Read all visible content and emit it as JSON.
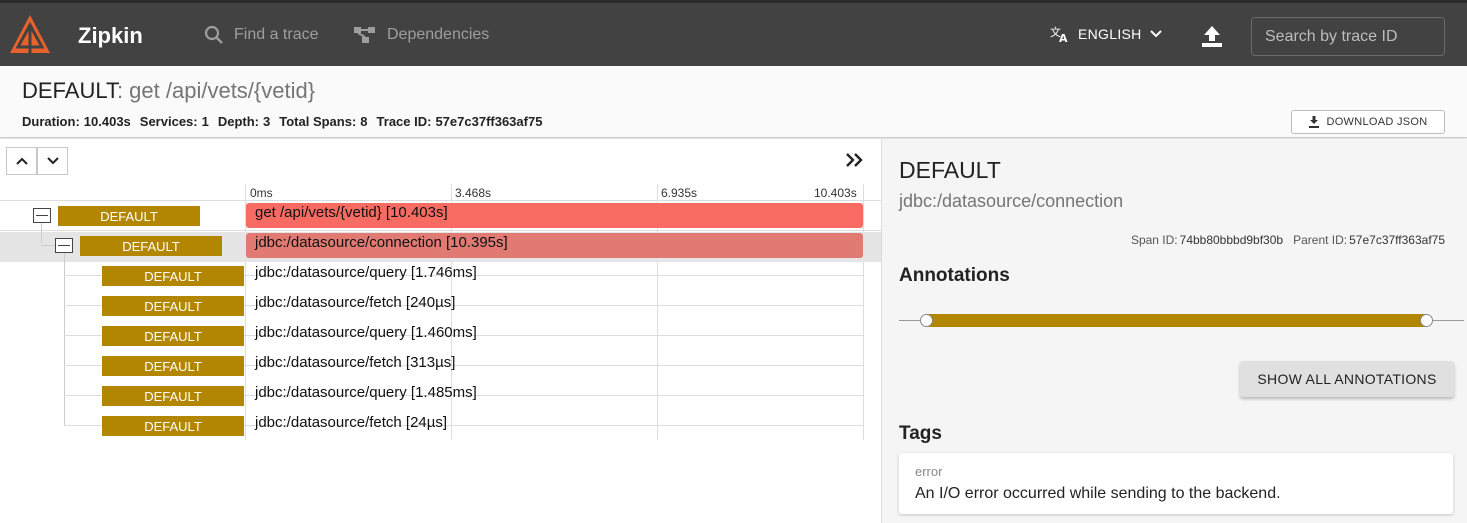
{
  "header": {
    "app_name": "Zipkin",
    "nav": [
      {
        "label": "Find a trace",
        "icon": "search-icon"
      },
      {
        "label": "Dependencies",
        "icon": "dependencies-icon"
      }
    ],
    "language": "ENGLISH",
    "search_placeholder": "Search by trace ID"
  },
  "trace": {
    "service": "DEFAULT",
    "root_name": ": get /api/vets/{vetid}",
    "stats": [
      {
        "label": "Duration:",
        "value": "10.403s"
      },
      {
        "label": "Services:",
        "value": "1"
      },
      {
        "label": "Depth:",
        "value": "3"
      },
      {
        "label": "Total Spans:",
        "value": "8"
      },
      {
        "label": "Trace ID:",
        "value": "57e7c37ff363af75"
      }
    ],
    "download_label": "DOWNLOAD JSON"
  },
  "timeline": {
    "ticks": [
      "0ms",
      "3.468s",
      "6.935s",
      "10.403s"
    ],
    "spans": [
      {
        "service": "DEFAULT",
        "name": "get /api/vets/{vetid} [10.403s]",
        "error": true,
        "duration_fraction": 1.0
      },
      {
        "service": "DEFAULT",
        "name": "jdbc:/datasource/connection [10.395s]",
        "error": true,
        "selected": true,
        "duration_fraction": 0.999
      },
      {
        "service": "DEFAULT",
        "name": "jdbc:/datasource/query [1.746ms]"
      },
      {
        "service": "DEFAULT",
        "name": "jdbc:/datasource/fetch [240µs]"
      },
      {
        "service": "DEFAULT",
        "name": "jdbc:/datasource/query [1.460ms]"
      },
      {
        "service": "DEFAULT",
        "name": "jdbc:/datasource/fetch [313µs]"
      },
      {
        "service": "DEFAULT",
        "name": "jdbc:/datasource/query [1.485ms]"
      },
      {
        "service": "DEFAULT",
        "name": "jdbc:/datasource/fetch [24µs]"
      }
    ],
    "colors": {
      "error_bar": "#f76b63",
      "error_bar_selected": "#e07a73",
      "service_badge": "#b38600"
    }
  },
  "detail": {
    "service": "DEFAULT",
    "span_name": "jdbc:/datasource/connection",
    "span_id_label": "Span ID:",
    "span_id": "74bb80bbbd9bf30b",
    "parent_id_label": "Parent ID:",
    "parent_id": "57e7c37ff363af75",
    "annotations_title": "Annotations",
    "show_all_label": "SHOW ALL ANNOTATIONS",
    "tags_title": "Tags",
    "tags": [
      {
        "key": "error",
        "value": "An I/O error occurred while sending to the backend."
      }
    ]
  }
}
